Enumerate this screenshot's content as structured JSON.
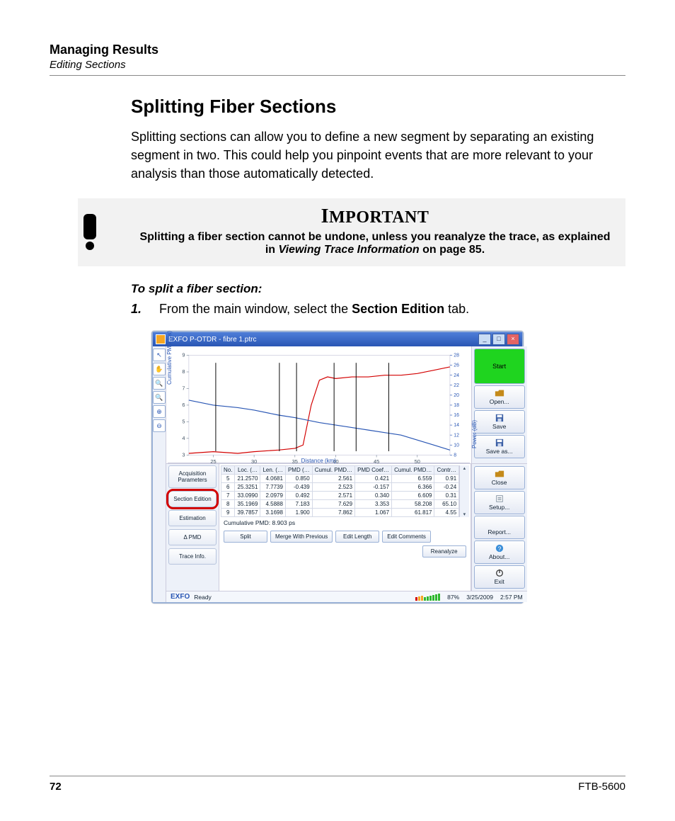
{
  "header": {
    "chapter": "Managing Results",
    "section": "Editing Sections"
  },
  "title": "Splitting Fiber Sections",
  "intro": "Splitting sections can allow you to define a new segment by separating an existing segment in two. This could help you pinpoint events that are more relevant to your analysis than those automatically detected.",
  "important": {
    "heading_first": "I",
    "heading_rest": "MPORTANT",
    "text_a": "Splitting a fiber section cannot be undone, unless you reanalyze the trace, as explained in ",
    "text_ital": "Viewing Trace Information",
    "text_b": " on page 85."
  },
  "howto": "To split a fiber section:",
  "step1": {
    "num": "1.",
    "a": "From the main window, select the ",
    "bold": "Section Edition",
    "b": " tab."
  },
  "screenshot": {
    "window_title": "EXFO P-OTDR - fibre 1.ptrc",
    "win_buttons": {
      "min": "_",
      "max": "□",
      "close": "×"
    },
    "tools": [
      "↖",
      "✋",
      "🔍",
      "🔍",
      "⊕",
      "⊖"
    ],
    "chart": {
      "y_label": "Cumulative PMD (ps)",
      "x_label": "Distance (km)",
      "y2_label": "Power (dB)",
      "y_ticks": [
        "9",
        "8",
        "7",
        "6",
        "5",
        "4",
        "3"
      ],
      "x_ticks": [
        "25",
        "30",
        "35",
        "40",
        "45",
        "50"
      ],
      "y2_ticks": [
        "28",
        "26",
        "24",
        "22",
        "20",
        "18",
        "16",
        "14",
        "12",
        "10",
        "8"
      ]
    },
    "side_buttons": [
      {
        "label": "Start",
        "kind": "start"
      },
      {
        "label": "Open...",
        "icon": "folder"
      },
      {
        "label": "Save",
        "icon": "save"
      },
      {
        "label": "Save as...",
        "icon": "save"
      },
      {
        "label": "Close",
        "icon": "folder"
      },
      {
        "label": "Setup...",
        "icon": "setup"
      },
      {
        "label": "Report...",
        "icon": "blank"
      },
      {
        "label": "About...",
        "icon": "info"
      },
      {
        "label": "Exit",
        "icon": "power"
      }
    ],
    "left_tabs": [
      {
        "label": "Acquisition Parameters"
      },
      {
        "label": "Section Edition",
        "highlight": true
      },
      {
        "label": "Estimation"
      },
      {
        "label": "Δ PMD"
      },
      {
        "label": "Trace Info."
      }
    ],
    "table": {
      "headers": [
        "No.",
        "Loc. (…",
        "Len. (…",
        "PMD (…",
        "Cumul. PMD…",
        "PMD Coef…",
        "Cumul. PMD…",
        "Contr…"
      ],
      "rows": [
        [
          "5",
          "21.2570",
          "4.0681",
          "0.850",
          "2.561",
          "0.421",
          "6.559",
          "0.91"
        ],
        [
          "6",
          "25.3251",
          "7.7739",
          "-0.439",
          "2.523",
          "-0.157",
          "6.366",
          "-0.24"
        ],
        [
          "7",
          "33.0990",
          "2.0979",
          "0.492",
          "2.571",
          "0.340",
          "6.609",
          "0.31"
        ],
        [
          "8",
          "35.1969",
          "4.5888",
          "7.183",
          "7.629",
          "3.353",
          "58.208",
          "65.10"
        ],
        [
          "9",
          "39.7857",
          "3.1698",
          "1.900",
          "7.862",
          "1.067",
          "61.817",
          "4.55"
        ]
      ]
    },
    "cumulative_label": "Cumulative PMD: 8.903 ps",
    "action_buttons": [
      "Split",
      "Merge With Previous",
      "Edit Length",
      "Edit Comments"
    ],
    "reanalyze": "Reanalyze",
    "statusbar": {
      "brand": "EXFO",
      "ready": "Ready",
      "battery_pct": "87%",
      "date": "3/25/2009",
      "time": "2:57 PM"
    }
  },
  "chart_data": {
    "type": "line",
    "title": "",
    "xlabel": "Distance (km)",
    "ylabel": "Cumulative PMD (ps)",
    "y2label": "Power (dB)",
    "xlim": [
      22,
      54
    ],
    "ylim": [
      3,
      9
    ],
    "y2lim": [
      8,
      28
    ],
    "series": [
      {
        "name": "Cumulative PMD (ps)",
        "axis": "y",
        "color": "#d30000",
        "x": [
          22,
          25,
          28,
          30,
          33,
          35,
          36,
          37,
          38,
          39,
          40,
          42,
          44,
          46,
          48,
          50,
          52,
          54
        ],
        "values": [
          3.1,
          3.2,
          3.1,
          3.2,
          3.3,
          3.4,
          3.6,
          6.0,
          7.5,
          7.7,
          7.6,
          7.7,
          7.7,
          7.8,
          7.8,
          7.9,
          8.1,
          8.3
        ]
      },
      {
        "name": "Power (dB)",
        "axis": "y2",
        "color": "#2956b4",
        "x": [
          22,
          25,
          28,
          30,
          33,
          35,
          38,
          40,
          42,
          44,
          46,
          48,
          50,
          52,
          54
        ],
        "values": [
          19,
          18,
          17.5,
          17,
          16,
          15.5,
          14.5,
          14,
          13.5,
          13,
          12.5,
          12,
          11,
          10,
          9
        ]
      }
    ],
    "markers_x": [
      25.3,
      33.1,
      35.2,
      39.8,
      42.5,
      46.5
    ]
  },
  "footer": {
    "page": "72",
    "product": "FTB-5600"
  }
}
